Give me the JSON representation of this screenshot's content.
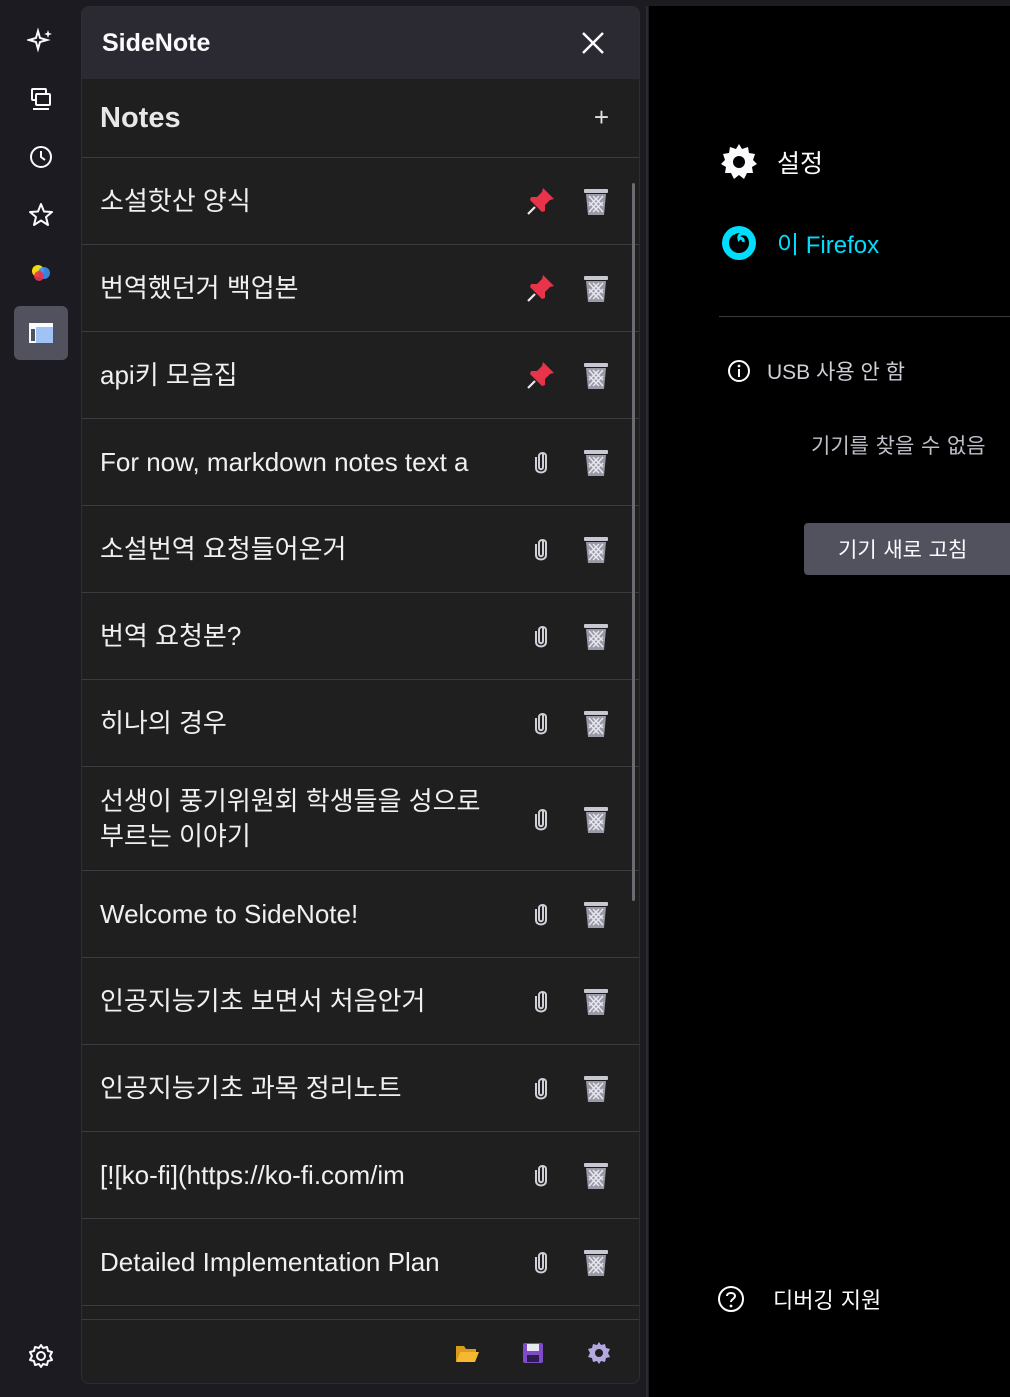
{
  "sidebar_panel": {
    "title": "SideNote",
    "notes_heading": "Notes",
    "add_label": "+"
  },
  "notes": [
    {
      "title": "소설핫산 양식",
      "pinned": true
    },
    {
      "title": "번역했던거 백업본",
      "pinned": true
    },
    {
      "title": "api키 모음집",
      "pinned": true
    },
    {
      "title": "For now, markdown notes text a",
      "pinned": false
    },
    {
      "title": "소설번역 요청들어온거",
      "pinned": false
    },
    {
      "title": "번역 요청본?",
      "pinned": false
    },
    {
      "title": "히나의 경우",
      "pinned": false
    },
    {
      "title": "선생이 풍기위원회 학생들을 성으로 부르는 이야기",
      "pinned": false
    },
    {
      "title": "Welcome to SideNote!",
      "pinned": false
    },
    {
      "title": "인공지능기초 보면서 처음안거",
      "pinned": false
    },
    {
      "title": "인공지능기초 과목 정리노트",
      "pinned": false
    },
    {
      "title": "[![ko-fi](https://ko-fi.com/im",
      "pinned": false
    },
    {
      "title": "Detailed Implementation Plan",
      "pinned": false
    }
  ],
  "right_page": {
    "settings_label": "설정",
    "firefox_label": "이 Firefox",
    "usb_status": "USB 사용 안 함",
    "no_devices": "기기를 찾을 수 없음",
    "refresh_button": "기기 새로 고침",
    "debug_help": "디버깅 지원"
  },
  "colors": {
    "accent_cyan": "#00ddff",
    "pin_red": "#e8344b",
    "folder_yellow": "#f5b82e",
    "save_purple": "#7f4cc9"
  }
}
